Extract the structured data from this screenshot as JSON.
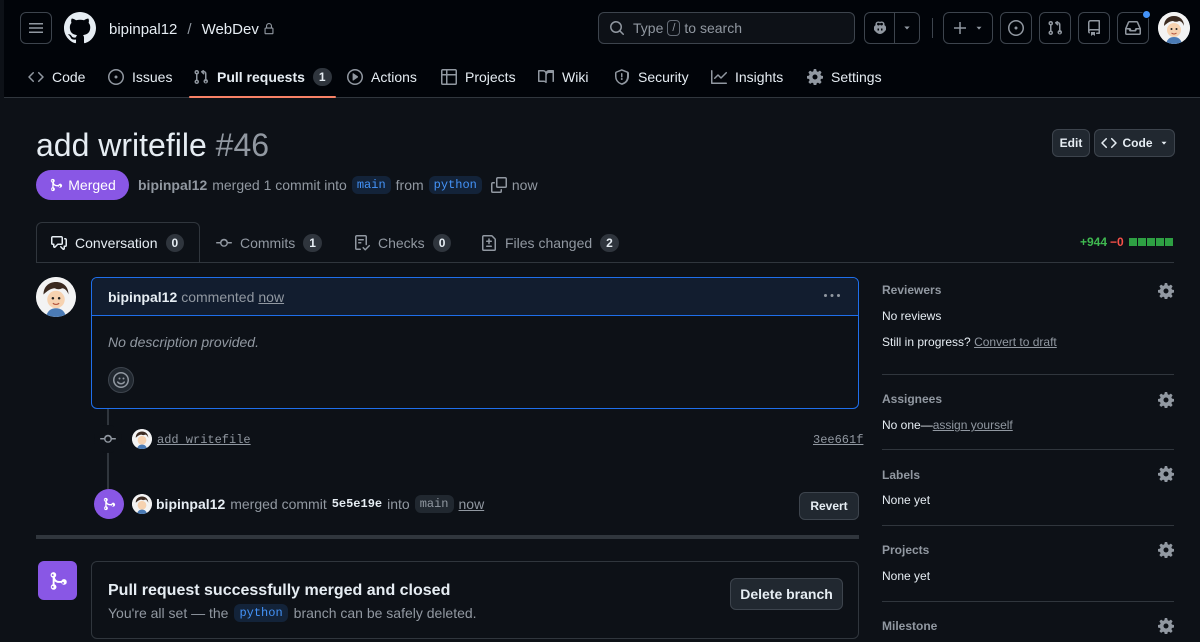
{
  "header": {
    "owner": "bipinpal12",
    "separator": "/",
    "repo": "WebDev",
    "search": {
      "prefix": "Type",
      "key": "/",
      "suffix": "to search"
    }
  },
  "repo_tabs": [
    {
      "label": "Code",
      "icon": "code-icon"
    },
    {
      "label": "Issues",
      "icon": "issue-opened-icon"
    },
    {
      "label": "Pull requests",
      "icon": "git-pull-request-icon",
      "count": "1"
    },
    {
      "label": "Actions",
      "icon": "play-icon"
    },
    {
      "label": "Projects",
      "icon": "table-icon"
    },
    {
      "label": "Wiki",
      "icon": "book-icon"
    },
    {
      "label": "Security",
      "icon": "shield-icon"
    },
    {
      "label": "Insights",
      "icon": "graph-icon"
    },
    {
      "label": "Settings",
      "icon": "gear-icon"
    }
  ],
  "pr": {
    "title": "add writefile",
    "number": "#46",
    "state": "Merged",
    "author": "bipinpal12",
    "merge_text": "merged 1 commit into",
    "base": "main",
    "from_text": "from",
    "head": "python",
    "time": "now",
    "edit_label": "Edit",
    "code_label": "Code",
    "diff_add": "+944",
    "diff_del": "−0"
  },
  "pr_tabs": [
    {
      "label": "Conversation",
      "count": "0",
      "icon": "comment-discussion-icon"
    },
    {
      "label": "Commits",
      "count": "1",
      "icon": "git-commit-icon"
    },
    {
      "label": "Checks",
      "count": "0",
      "icon": "checklist-icon"
    },
    {
      "label": "Files changed",
      "count": "2",
      "icon": "file-diff-icon"
    }
  ],
  "comment": {
    "author": "bipinpal12",
    "action": "commented",
    "time": "now",
    "body": "No description provided."
  },
  "commit_event": {
    "message": "add writefile",
    "sha": "3ee661f"
  },
  "merge_event": {
    "author": "bipinpal12",
    "text": "merged commit",
    "sha": "5e5e19e",
    "into": "into",
    "branch": "main",
    "time": "now",
    "revert_label": "Revert"
  },
  "merged_box": {
    "title": "Pull request successfully merged and closed",
    "text_before": "You're all set — the",
    "branch": "python",
    "text_after": "branch can be safely deleted.",
    "delete_label": "Delete branch"
  },
  "sidebar": {
    "reviewers": {
      "title": "Reviewers",
      "value": "No reviews",
      "progress": "Still in progress?",
      "draft_link": "Convert to draft"
    },
    "assignees": {
      "title": "Assignees",
      "value": "No one—",
      "link": "assign yourself"
    },
    "labels": {
      "title": "Labels",
      "value": "None yet"
    },
    "projects": {
      "title": "Projects",
      "value": "None yet"
    },
    "milestone": {
      "title": "Milestone"
    }
  },
  "colors": {
    "merged": "#8957e5",
    "accent_underline": "#f78166",
    "add": "#3fb950",
    "del": "#f85149",
    "link": "#4493f8"
  }
}
